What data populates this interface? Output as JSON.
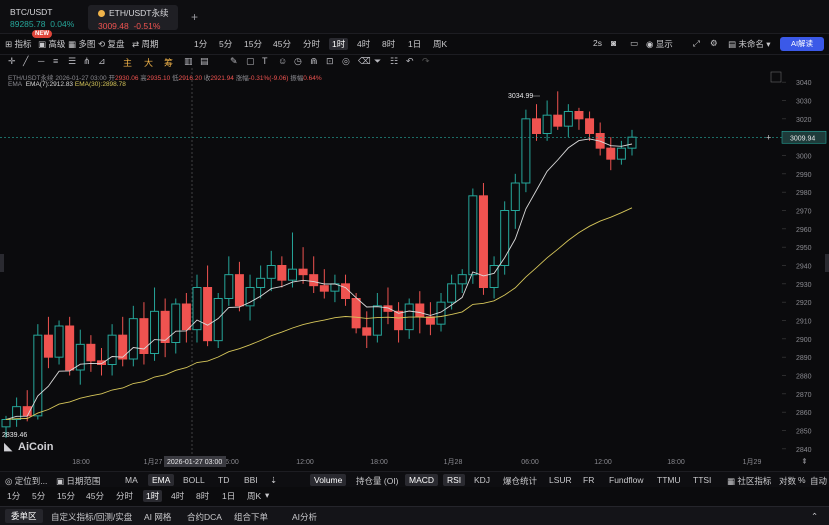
{
  "tabs": [
    {
      "symbol": "BTC/USDT",
      "price": "89285.78",
      "change": "0.04%",
      "active": false
    },
    {
      "symbol": "ETH/USDT永续",
      "price": "3009.48",
      "change": "-0.51%",
      "active": true
    }
  ],
  "toolbar": {
    "items": [
      "指标",
      "高级",
      "多图",
      "复盘",
      "周期",
      "1分",
      "5分",
      "15分",
      "45分",
      "分时",
      "1时",
      "4时",
      "8时",
      "1日",
      "周K"
    ],
    "active": "1时",
    "new_badge": "NEW",
    "right_items": [
      "2s",
      "显示",
      "未命名"
    ],
    "ai_button": "AI解读"
  },
  "drawbar": {
    "labels": [
      "主",
      "大",
      "筹"
    ]
  },
  "info": {
    "symbol": "ETH/USDT永续",
    "time": "2026-01-27 03:00",
    "open_label": "开",
    "open": "2930.06",
    "high_label": "高",
    "high": "2935.10",
    "low_label": "低",
    "low": "2916.20",
    "close_label": "收",
    "close": "2921.94",
    "change_label": "涨幅",
    "change": "-0.31%(-9.06)",
    "amp_label": "振幅",
    "amp": "0.64%",
    "ema_title": "EMA",
    "ema7": "EMA(7):2912.83",
    "ema30": "EMA(30):2898.78"
  },
  "chart_data": {
    "type": "candlestick",
    "y_axis_ticks": [
      3040,
      3030,
      3020,
      3010,
      3000,
      2990,
      2980,
      2970,
      2960,
      2950,
      2940,
      2930,
      2920,
      2910,
      2900,
      2890,
      2880,
      2870,
      2860,
      2850,
      2840
    ],
    "ylim": [
      2835,
      3045
    ],
    "x_axis_labels": [
      "18:00",
      "1月27",
      "06:00",
      "12:00",
      "18:00",
      "1月28",
      "06:00",
      "12:00",
      "18:00",
      "1月29"
    ],
    "crosshair_time": "2026-01-27 03:00",
    "current_price": "3009.94",
    "high_marker": "3034.99",
    "low_marker": "2839.46",
    "watermark": "AiCoin",
    "candles": [
      [
        2852,
        2858,
        2846,
        2856
      ],
      [
        2856,
        2868,
        2852,
        2863
      ],
      [
        2863,
        2872,
        2855,
        2858
      ],
      [
        2858,
        2908,
        2856,
        2902
      ],
      [
        2902,
        2912,
        2884,
        2890
      ],
      [
        2890,
        2910,
        2886,
        2907
      ],
      [
        2907,
        2912,
        2880,
        2883
      ],
      [
        2883,
        2905,
        2875,
        2897
      ],
      [
        2897,
        2902,
        2882,
        2888
      ],
      [
        2888,
        2895,
        2880,
        2886
      ],
      [
        2886,
        2908,
        2880,
        2902
      ],
      [
        2902,
        2912,
        2885,
        2889
      ],
      [
        2889,
        2918,
        2885,
        2911
      ],
      [
        2911,
        2920,
        2886,
        2892
      ],
      [
        2892,
        2928,
        2888,
        2915
      ],
      [
        2915,
        2922,
        2890,
        2898
      ],
      [
        2898,
        2922,
        2892,
        2919
      ],
      [
        2919,
        2925,
        2898,
        2905
      ],
      [
        2905,
        2935,
        2898,
        2928
      ],
      [
        2928,
        2940,
        2896,
        2899
      ],
      [
        2899,
        2925,
        2895,
        2922
      ],
      [
        2922,
        2945,
        2918,
        2935
      ],
      [
        2935,
        2942,
        2915,
        2918
      ],
      [
        2918,
        2935,
        2910,
        2928
      ],
      [
        2928,
        2940,
        2922,
        2933
      ],
      [
        2933,
        2948,
        2926,
        2940
      ],
      [
        2940,
        2945,
        2928,
        2932
      ],
      [
        2932,
        2958,
        2928,
        2938
      ],
      [
        2938,
        2950,
        2930,
        2935
      ],
      [
        2935,
        2945,
        2925,
        2929
      ],
      [
        2929,
        2938,
        2922,
        2926
      ],
      [
        2926,
        2935,
        2920,
        2930
      ],
      [
        2930,
        2935,
        2918,
        2922
      ],
      [
        2922,
        2925,
        2903,
        2906
      ],
      [
        2906,
        2915,
        2895,
        2902
      ],
      [
        2902,
        2925,
        2898,
        2918
      ],
      [
        2918,
        2928,
        2908,
        2915
      ],
      [
        2915,
        2920,
        2898,
        2905
      ],
      [
        2905,
        2922,
        2900,
        2919
      ],
      [
        2919,
        2926,
        2903,
        2912
      ],
      [
        2912,
        2920,
        2902,
        2908
      ],
      [
        2908,
        2925,
        2904,
        2920
      ],
      [
        2920,
        2935,
        2916,
        2930
      ],
      [
        2930,
        2938,
        2925,
        2935
      ],
      [
        2935,
        2982,
        2930,
        2978
      ],
      [
        2978,
        2985,
        2924,
        2928
      ],
      [
        2928,
        2945,
        2922,
        2940
      ],
      [
        2940,
        2975,
        2935,
        2970
      ],
      [
        2970,
        2990,
        2960,
        2985
      ],
      [
        2985,
        3025,
        2980,
        3020
      ],
      [
        3020,
        3028,
        3008,
        3012
      ],
      [
        3012,
        3030,
        3008,
        3022
      ],
      [
        3022,
        3035,
        3014,
        3016
      ],
      [
        3016,
        3028,
        3010,
        3024
      ],
      [
        3024,
        3026,
        3014,
        3020
      ],
      [
        3020,
        3024,
        3008,
        3012
      ],
      [
        3012,
        3018,
        3000,
        3004
      ],
      [
        3004,
        3010,
        2992,
        2998
      ],
      [
        2998,
        3008,
        2995,
        3004
      ],
      [
        3004,
        3014,
        3000,
        3010
      ]
    ]
  },
  "indicators": {
    "left": [
      "定位到...",
      "日期范围"
    ],
    "main": [
      "MA",
      "EMA",
      "BOLL",
      "TD",
      "BBI"
    ],
    "main_active": "EMA",
    "sub": [
      "Volume",
      "持仓量 (OI)",
      "MACD",
      "RSI",
      "KDJ",
      "爆仓统计",
      "LSUR",
      "FR",
      "Fundflow",
      "TTMU",
      "TTSI"
    ],
    "sub_active": [
      "Volume",
      "MACD",
      "RSI"
    ],
    "right": [
      "社区指标",
      "对数",
      "%",
      "自动"
    ]
  },
  "periods": {
    "items": [
      "1分",
      "5分",
      "15分",
      "45分",
      "分时",
      "1时",
      "4时",
      "8时",
      "1日",
      "周K"
    ],
    "active": "1时"
  },
  "panel_tabs": [
    "委单区",
    "自定义指标/回测/实盘",
    "AI 网格",
    "合约DCA",
    "组合下单",
    "AI分析"
  ],
  "colors": {
    "up": "#26a69a",
    "down": "#ef5350",
    "ema7": "#d9d9d9",
    "ema30": "#d6c65a",
    "accent": "#3b59e8"
  }
}
